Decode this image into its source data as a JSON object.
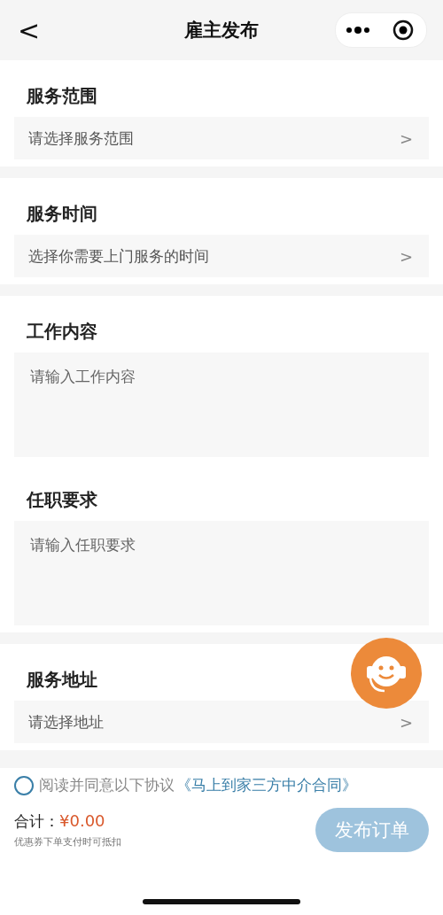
{
  "nav": {
    "back": "<",
    "title": "雇主发布"
  },
  "sections": [
    {
      "title": "服务范围",
      "kind": "select",
      "placeholder": "请选择服务范围",
      "chevron": ">"
    },
    {
      "title": "服务时间",
      "kind": "select",
      "placeholder": "选择你需要上门服务的时间",
      "chevron": ">"
    },
    {
      "title": "工作内容",
      "kind": "textarea",
      "placeholder": "请输入工作内容"
    },
    {
      "title": "任职要求",
      "kind": "textarea",
      "placeholder": "请输入任职要求"
    },
    {
      "title": "服务地址",
      "kind": "select",
      "placeholder": "请选择地址",
      "chevron": ">"
    }
  ],
  "agreement": {
    "checked": false,
    "text": "阅读并同意以下协议",
    "link": "《马上到家三方中介合同》"
  },
  "footer": {
    "total_label": "合计：",
    "total": "¥0.00",
    "note": "优惠券下单支付时可抵扣",
    "submit": "发布订单",
    "submit_disabled": true
  }
}
